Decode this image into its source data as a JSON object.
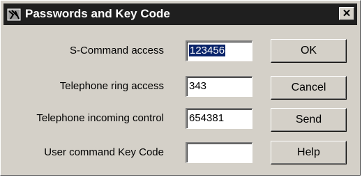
{
  "window": {
    "title": "Passwords and Key Code",
    "close_glyph": "✕"
  },
  "fields": [
    {
      "label": "S-Command access",
      "value": "123456",
      "selected": true
    },
    {
      "label": "Telephone ring access",
      "value": "343",
      "selected": false
    },
    {
      "label": "Telephone incoming control",
      "value": "654381",
      "selected": false
    },
    {
      "label": "User command Key Code",
      "value": "",
      "selected": false
    }
  ],
  "buttons": {
    "ok": "OK",
    "cancel": "Cancel",
    "send": "Send",
    "help": "Help"
  },
  "colors": {
    "titlebar": "#1f1f1f",
    "face": "#d4d0c8",
    "selection": "#0a246a"
  },
  "icons": {
    "app": "app-icon",
    "close": "close-icon"
  }
}
